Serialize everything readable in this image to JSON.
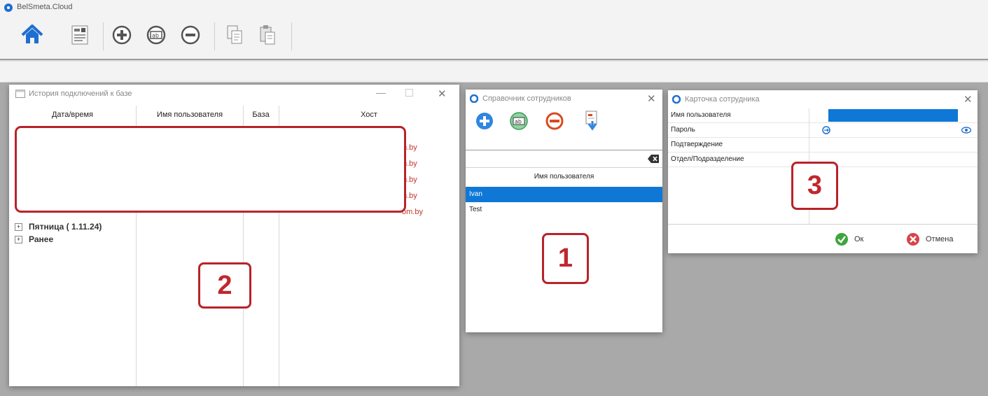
{
  "app": {
    "title": "BelSmeta.Cloud"
  },
  "toolbar": {
    "buttons": [
      {
        "name": "home-button",
        "icon": "home-icon"
      },
      {
        "name": "form-button",
        "icon": "form-icon"
      },
      {
        "name": "add-button",
        "icon": "plus-circle-icon"
      },
      {
        "name": "rename-button",
        "icon": "ab-field-icon"
      },
      {
        "name": "remove-button",
        "icon": "minus-circle-icon"
      },
      {
        "name": "copy-button",
        "icon": "copy-icon"
      },
      {
        "name": "paste-button",
        "icon": "paste-icon"
      }
    ]
  },
  "history": {
    "title": "История подключений к базе",
    "columns": [
      "Дата/время",
      "Имя пользователя",
      "База",
      "Хост"
    ],
    "host_fragments": [
      "n.by",
      "n.by",
      "n.by",
      "n.by",
      "om.by"
    ],
    "groups": [
      "Пятница ( 1.11.24)",
      "Ранее"
    ],
    "callout": "2"
  },
  "employees": {
    "title": "Справочник сотрудников",
    "column": "Имя пользователя",
    "rows": [
      "Ivan",
      "Test"
    ],
    "selected": "Ivan",
    "callout": "1"
  },
  "card": {
    "title": "Карточка сотрудника",
    "fields": [
      "Имя пользователя",
      "Пароль",
      "Подтверждение",
      "Отдел/Подразделение"
    ],
    "ok_label": "Ок",
    "cancel_label": "Отмена",
    "callout": "3"
  },
  "colors": {
    "accent": "#0f78d7",
    "callout": "#c0272d",
    "host_text": "#c0392b"
  }
}
